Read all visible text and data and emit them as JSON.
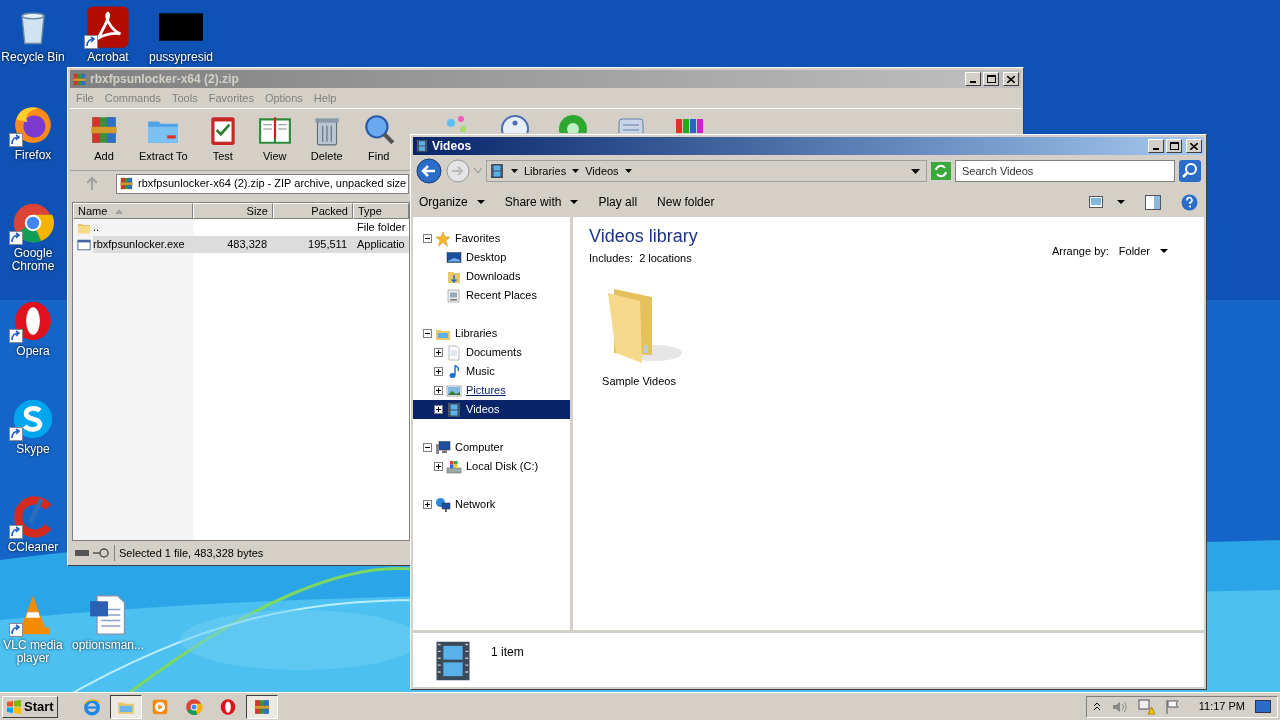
{
  "desktop_icons": [
    {
      "label": "Recycle Bin",
      "kind": "recycle",
      "shortcut": false
    },
    {
      "label": "Acrobat",
      "kind": "pdf",
      "shortcut": true
    },
    {
      "label": "pussypresid",
      "kind": "redacted",
      "shortcut": false
    },
    {
      "label": "Firefox",
      "kind": "firefox",
      "shortcut": true
    },
    {
      "label": "Google Chrome",
      "kind": "chrome",
      "shortcut": true
    },
    {
      "label": "Opera",
      "kind": "opera",
      "shortcut": true
    },
    {
      "label": "Skype",
      "kind": "skype",
      "shortcut": true
    },
    {
      "label": "CCleaner",
      "kind": "ccleaner",
      "shortcut": true
    },
    {
      "label": "VLC media player",
      "kind": "vlc",
      "shortcut": true
    },
    {
      "label": "optionsman...",
      "kind": "word",
      "shortcut": false
    }
  ],
  "archiver": {
    "title": "rbxfpsunlocker-x64 (2).zip",
    "menu": [
      "File",
      "Commands",
      "Tools",
      "Favorites",
      "Options",
      "Help"
    ],
    "toolbar": [
      {
        "label": "Add",
        "kind": "add"
      },
      {
        "label": "Extract To",
        "kind": "extract"
      },
      {
        "label": "Test",
        "kind": "test"
      },
      {
        "label": "View",
        "kind": "view"
      },
      {
        "label": "Delete",
        "kind": "delete"
      },
      {
        "label": "Find",
        "kind": "find"
      },
      {
        "kind": "wizard"
      },
      {
        "kind": "info"
      },
      {
        "kind": "scan"
      },
      {
        "kind": "comment"
      },
      {
        "kind": "sfx"
      }
    ],
    "address": "rbxfpsunlocker-x64 (2).zip - ZIP archive, unpacked size",
    "columns": [
      "Name",
      "Size",
      "Packed",
      "Type"
    ],
    "rows": [
      {
        "name": "..",
        "size": "",
        "packed": "",
        "type": "File folder",
        "kind": "folder",
        "selected": false
      },
      {
        "name": "rbxfpsunlocker.exe",
        "size": "483,328",
        "packed": "195,511",
        "type": "Applicatio",
        "kind": "exe",
        "selected": true
      }
    ],
    "status": "Selected 1 file, 483,328 bytes"
  },
  "explorer": {
    "title": "Videos",
    "breadcrumb": [
      "Libraries",
      "Videos"
    ],
    "search": {
      "placeholder": "Search Videos"
    },
    "commands": [
      {
        "label": "Organize",
        "has_menu": true
      },
      {
        "label": "Share with",
        "has_menu": true
      },
      {
        "label": "Play all",
        "has_menu": false
      },
      {
        "label": "New folder",
        "has_menu": false
      }
    ],
    "nav_tree": [
      {
        "label": "Favorites",
        "kind": "star",
        "expanded": true,
        "selected": false,
        "hovered": false,
        "children": [
          {
            "label": "Desktop",
            "kind": "desktop",
            "selected": false,
            "hovered": false
          },
          {
            "label": "Downloads",
            "kind": "downloads",
            "selected": false,
            "hovered": false
          },
          {
            "label": "Recent Places",
            "kind": "recent",
            "selected": false,
            "hovered": false
          }
        ]
      },
      {
        "label": "Libraries",
        "kind": "libraries",
        "expanded": true,
        "selected": false,
        "hovered": false,
        "children": [
          {
            "label": "Documents",
            "kind": "documents",
            "expanded": false,
            "selected": false,
            "hovered": false
          },
          {
            "label": "Music",
            "kind": "music",
            "expanded": false,
            "selected": false,
            "hovered": false
          },
          {
            "label": "Pictures",
            "kind": "pictures",
            "expanded": false,
            "selected": false,
            "hovered": true
          },
          {
            "label": "Videos",
            "kind": "videos",
            "expanded": false,
            "selected": true,
            "hovered": false
          }
        ]
      },
      {
        "label": "Computer",
        "kind": "computer",
        "expanded": true,
        "selected": false,
        "hovered": false,
        "children": [
          {
            "label": "Local Disk (C:)",
            "kind": "disk",
            "expanded": false,
            "selected": false,
            "hovered": false
          }
        ]
      },
      {
        "label": "Network",
        "kind": "network",
        "expanded": false,
        "selected": false,
        "hovered": false
      }
    ],
    "library_title": "Videos library",
    "includes": "Includes:  2 locations",
    "arrange_label": "Arrange by:",
    "arrange_value": "Folder",
    "items": [
      {
        "label": "Sample Videos"
      }
    ],
    "details": "1 item"
  },
  "taskbar": {
    "start": "Start",
    "apps": [
      {
        "kind": "ie",
        "active": false
      },
      {
        "kind": "explorer",
        "active": true
      },
      {
        "kind": "media",
        "active": false
      },
      {
        "kind": "chrome",
        "active": false
      },
      {
        "kind": "opera",
        "active": false
      },
      {
        "kind": "winrar",
        "active": true
      }
    ],
    "clock": "11:17 PM"
  }
}
